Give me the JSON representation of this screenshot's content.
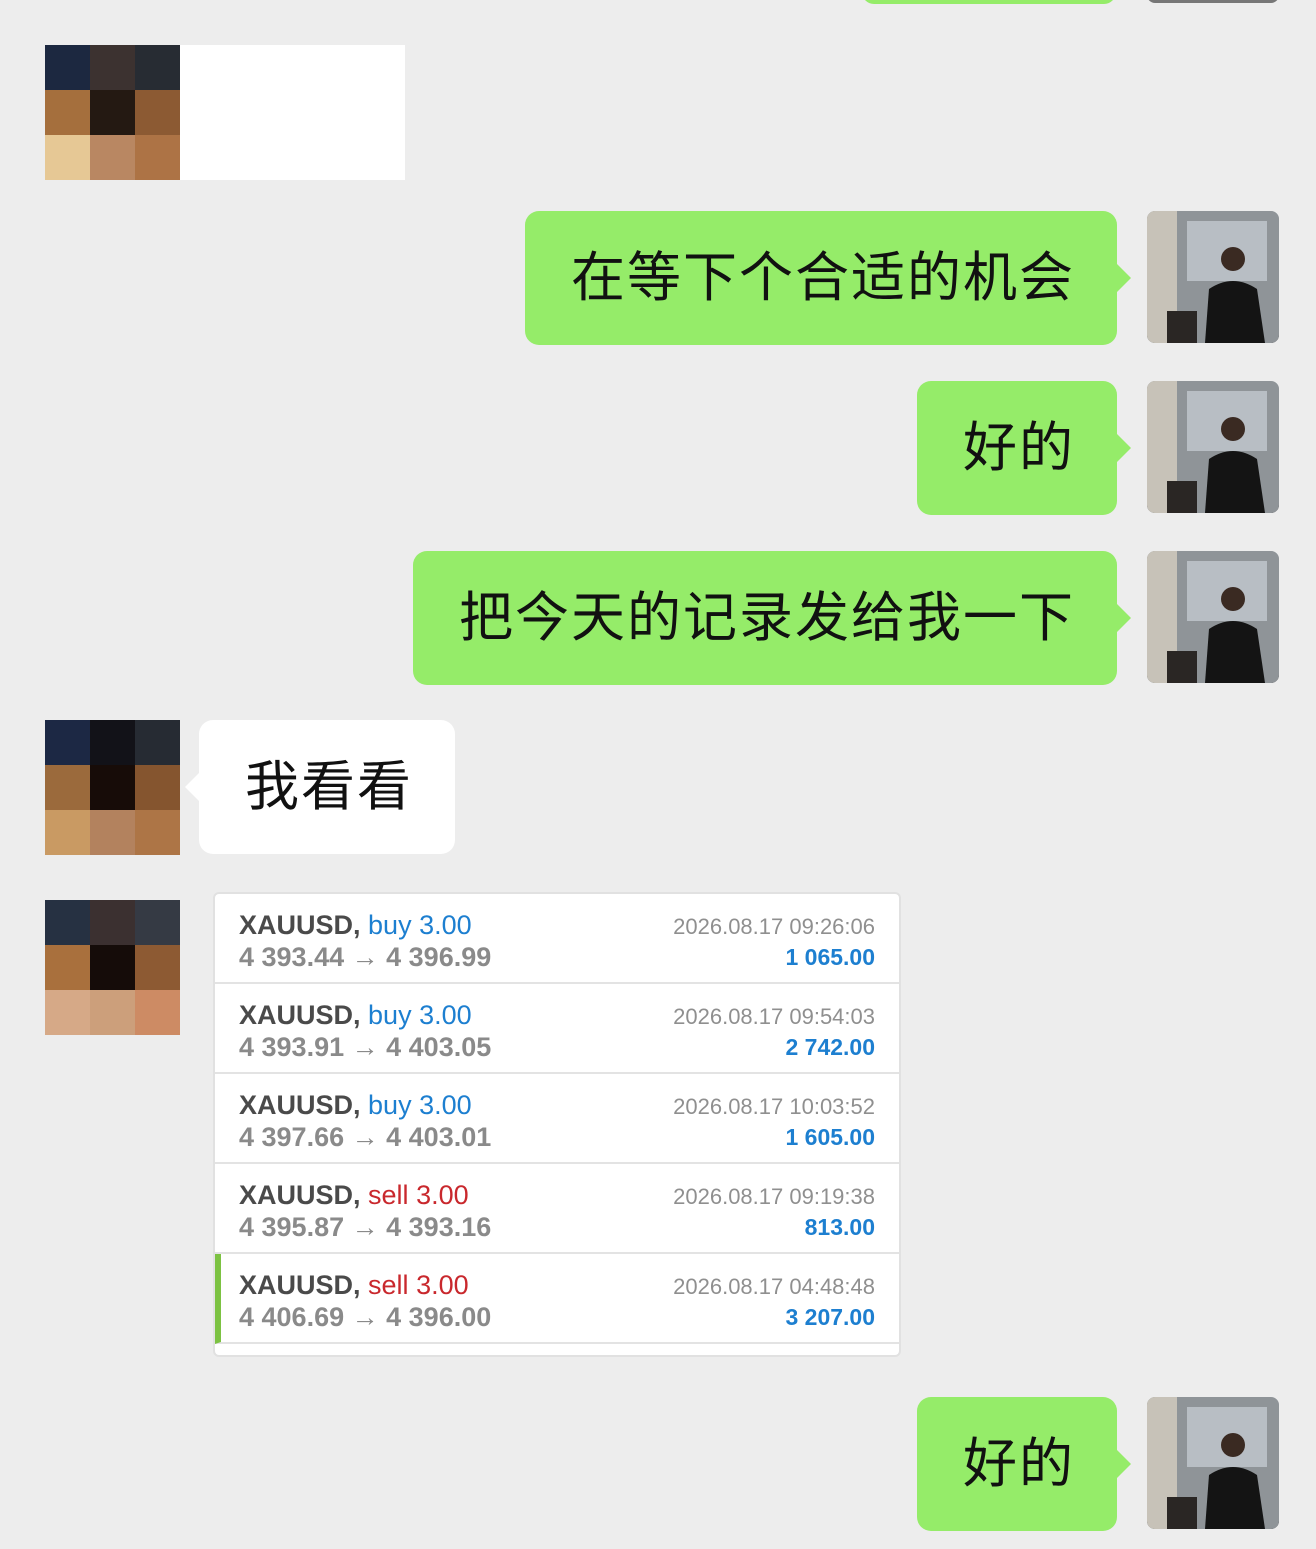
{
  "messages": [
    {
      "side": "left",
      "text": ""
    },
    {
      "side": "right",
      "text": "在等下个合适的机会"
    },
    {
      "side": "right",
      "text": "好的"
    },
    {
      "side": "right",
      "text": "把今天的记录发给我一下"
    },
    {
      "side": "left",
      "text": "我看看"
    },
    {
      "side": "right",
      "text": "好的"
    }
  ],
  "trades": [
    {
      "symbol": "XAUUSD,",
      "direction": "buy",
      "lots": "3.00",
      "open": "4 393.44",
      "close": "4 396.99",
      "arrow": "→",
      "time": "2026.08.17 09:26:06",
      "profit": "1 065.00"
    },
    {
      "symbol": "XAUUSD,",
      "direction": "buy",
      "lots": "3.00",
      "open": "4 393.91",
      "close": "4 403.05",
      "arrow": "→",
      "time": "2026.08.17 09:54:03",
      "profit": "2 742.00"
    },
    {
      "symbol": "XAUUSD,",
      "direction": "buy",
      "lots": "3.00",
      "open": "4 397.66",
      "close": "4 403.01",
      "arrow": "→",
      "time": "2026.08.17 10:03:52",
      "profit": "1 605.00"
    },
    {
      "symbol": "XAUUSD,",
      "direction": "sell",
      "lots": "3.00",
      "open": "4 395.87",
      "close": "4 393.16",
      "arrow": "→",
      "time": "2026.08.17 09:19:38",
      "profit": "813.00"
    },
    {
      "symbol": "XAUUSD,",
      "direction": "sell",
      "lots": "3.00",
      "open": "4 406.69",
      "close": "4 396.00",
      "arrow": "→",
      "time": "2026.08.17 04:48:48",
      "profit": "3 207.00"
    }
  ],
  "colors": {
    "background": "#ededed",
    "bubble_green": "#95ec69",
    "bubble_white": "#ffffff",
    "buy": "#1d7fd0",
    "sell": "#c9282d",
    "profit": "#1d7fd0",
    "active_marker": "#7cc242"
  },
  "avatars": {
    "contact": "pixelated-avatar",
    "self": "photo-avatar"
  }
}
